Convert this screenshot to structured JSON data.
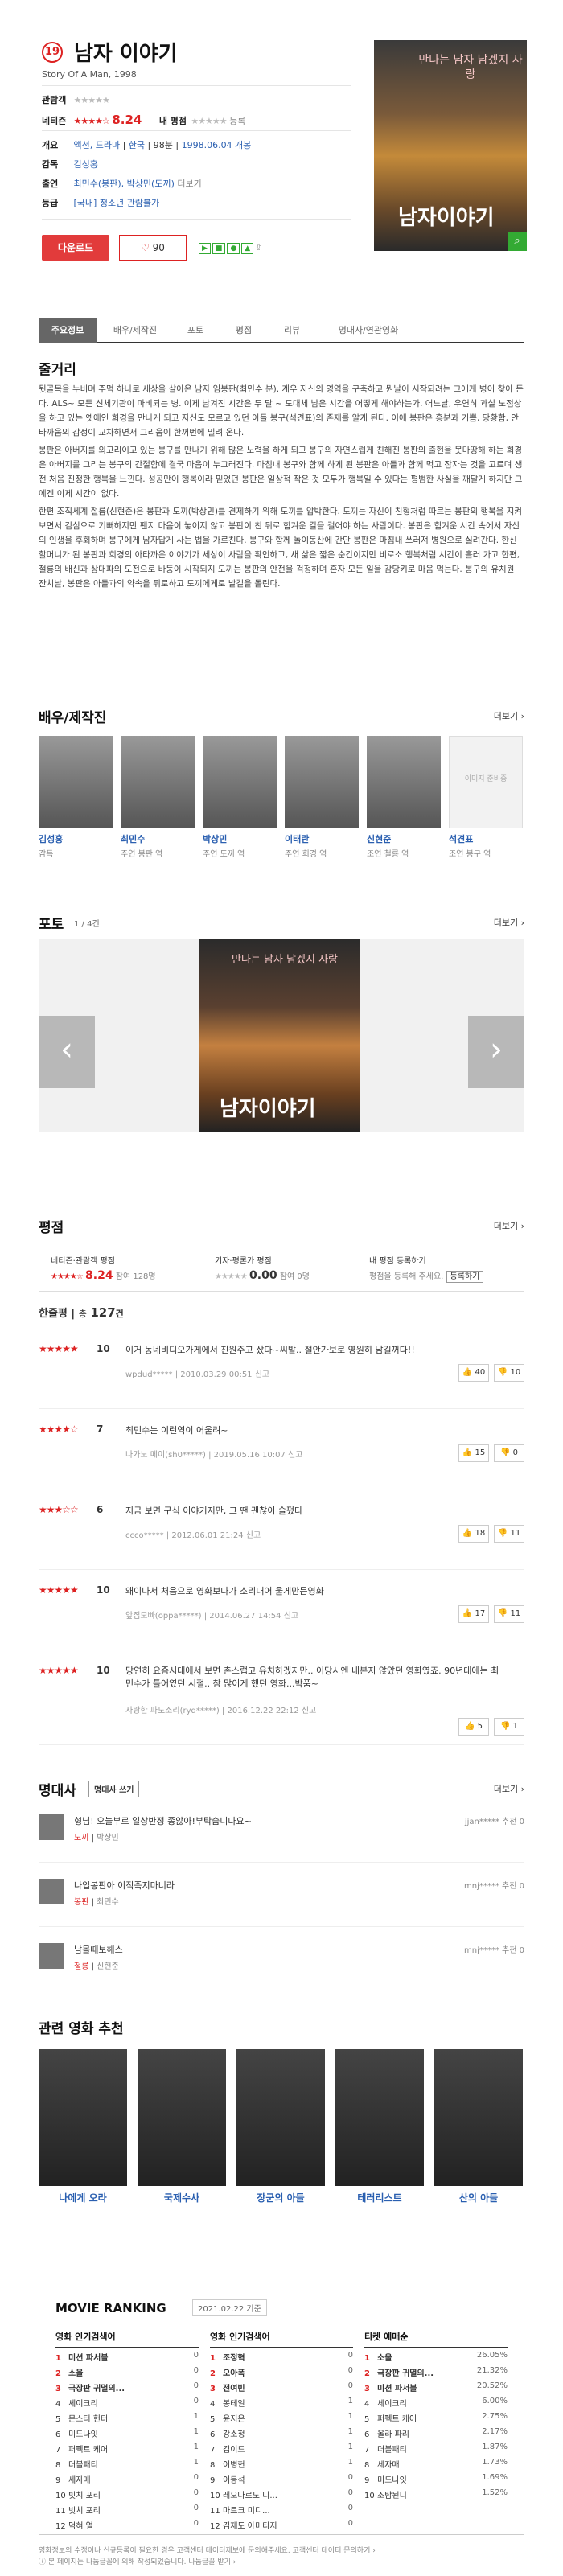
{
  "movie": {
    "rank": "19",
    "title": "남자 이야기",
    "subtitle": "Story Of A Man, 1998",
    "my_rating_label": "관람객",
    "netizen_label": "네티즌",
    "netizen_score": "8.24",
    "my_label": "내 평점",
    "my_link": "등록",
    "genre_label": "개요",
    "genre": "액션, 드라마",
    "country": "한국",
    "runtime": "98분",
    "release": "1998.06.04 개봉",
    "director_label": "감독",
    "director": "김성홍",
    "cast_label": "출연",
    "cast": "최민수(봉판), 박상민(도끼)",
    "cast_more": "더보기",
    "grade_label": "등급",
    "grade": "[국내] 청소년 관람불가",
    "download": "다운로드",
    "likes": "90",
    "poster_title": "남자이야기",
    "poster_sub": "만나는 남자 남겠지 사랑"
  },
  "tabs": [
    "주요정보",
    "배우/제작진",
    "포토",
    "평점",
    "리뷰",
    "명대사/연관영화"
  ],
  "plot": {
    "title": "줄거리",
    "p1": "뒷골목을 누비며 주먹 하나로 세상을 살아온 남자 임봉판(최민수 분). 계우 자신의 영역을 구축하고 뭔날이 시작되려는 그에게 병이 찾아 든다. ALS~ 모든 신체기관이 마비되는 병. 이제 남겨진 시간은 두 달 ~ 도대체 남은 시간을 어떻게 해야하는가. 어느날, 우연히 과실 노점상을 하고 있는 옛애인 희경을 만나게 되고 자신도 모르고 있던 아들 봉구(석견표)의 존재를 알게 된다. 이에 봉판은 흥분과 기쁨, 당황함, 안타까움의 감정이 교차하면서 그리움이 한꺼번에 밀려 온다.",
    "p2": "봉판은 아버지를 외고리이고 있는 봉구를 만나기 위해 많은 노력을 하게 되고 봉구의 자연스럽게 친해진 봉판의 출현을 못마땅해 하는 희경은 아버지를 그리는 봉구의 간절함에 결국 마음이 누그러진다. 마침내 봉구와 함께 하게 된 봉판은 아들과 함께 먹고 잠자는 것을 고르며 생전 처음 진정한 행복을 느낀다. 성공만이 행복이라 믿었던 봉판은 일상적 작은 것 모두가 행복일 수 있다는 평범한 사실을 깨달게 하지만 그에겐 이제 시간이 없다.",
    "p3": "한편 조직세계 절름(신현준)은 봉판과 도끼(박상민)를 견제하기 위해 도끼를 압박한다. 도끼는 자신이 친형처럼 따르는 봉판의 행복을 지켜 보면서 김심으로 기뻐하지만 팬지 마음이 놓이지 않고 봉판이 친 뒤로 힘겨운 길을 걸어야 하는 사람이다. 봉판은 힘겨운 시간 속에서 자신의 인생을 후회하며 봉구에게 남자답게 사는 법을 가르친다. 봉구와 함께 놀이동산에 간단 봉판은 마침내 쓰러져 병원으로 실려간다. 한신할머니가 된 봉판과 희경의 아타까운 이야기가 세상이 사람을 확인하고, 새 삶은 짧은 순간이지만 비로소 행복처럼 시간이 흘러 가고 한편, 철룡의 배신과 상대파의 도전으로 바둥이 시작되지 도끼는 봉판의 안전을 걱정하며 혼자 모든 일을 감당키로 마음 먹는다. 봉구의 유치원 잔치날, 봉판은 아들과의 약속을 뒤로하고 도끼에게로 발길을 돌린다."
  },
  "cast_section": {
    "title": "배우/제작진",
    "more": "더보기",
    "people": [
      {
        "name": "김성홍",
        "role": "감독"
      },
      {
        "name": "최민수",
        "role": "주연 봉판 역"
      },
      {
        "name": "박상민",
        "role": "주연 도끼 역"
      },
      {
        "name": "이태란",
        "role": "주연 희경 역"
      },
      {
        "name": "신현준",
        "role": "조연 철룡 역"
      },
      {
        "name": "석견표",
        "role": "조연 봉구 역"
      }
    ],
    "no_image": "이미지 준비중"
  },
  "photo": {
    "title": "포토",
    "count": "1 / 4건",
    "more": "더보기",
    "poster_title": "남자이야기",
    "poster_sub": "만나는 남자 남겠지 사랑"
  },
  "rating": {
    "title": "평점",
    "more": "더보기",
    "a_label": "네티즌·관람객 평점",
    "a_score": "8.24",
    "a_count": "참여 128명",
    "b_label": "기자·평론가 평점",
    "b_score": "0.00",
    "b_count": "참여 0명",
    "c_label": "내 평점 등록하기",
    "c_desc": "평점을 등록해 주세요.",
    "c_btn": "등록하기",
    "sub": "한줄평",
    "total_label": "총",
    "total": "127",
    "total_unit": "건"
  },
  "comments": [
    {
      "stars": "★★★★★",
      "score": "10",
      "text": "이거 동네비디오가게에서 친원주고 샀다~씨발.. 절안가보로 영원히 남길꺼다!!",
      "meta": "wpdud*****  |  2010.03.29 00:51  신고",
      "like": "40",
      "dislike": "10"
    },
    {
      "stars": "★★★★☆",
      "score": "7",
      "text": "최민수는 이런역이 어울려~",
      "meta": "나가노 메이(sh0*****)  |  2019.05.16 10:07  신고",
      "like": "15",
      "dislike": "0"
    },
    {
      "stars": "★★★☆☆",
      "score": "6",
      "text": "지금 보면 구식 이야기지만, 그 땐 괜찮이 슬펐다",
      "meta": "ccco*****  |  2012.06.01 21:24  신고",
      "like": "18",
      "dislike": "11"
    },
    {
      "stars": "★★★★★",
      "score": "10",
      "text": "왜이나서 처음으로 영화보다가 소리내어 울게만든영화",
      "meta": "앞집모빠(oppa*****)  |  2014.06.27 14:54  신고",
      "like": "17",
      "dislike": "11"
    },
    {
      "stars": "★★★★★",
      "score": "10",
      "text": "당연히 요즘시대에서 보면 촌스럽고 유치하겠지만.. 이당시엔 내본지 않았던 영화였죠. 90년대에는 최민수가 틀어였던 시절.. 참 많이게 했던 영화...박품~",
      "meta": "사랑한 파도소리(ryd*****)  |  2016.12.22 22:12  신고",
      "like": "5",
      "dislike": "1"
    }
  ],
  "quotes": {
    "title": "명대사",
    "btn": "명대사 쓰기",
    "more": "더보기",
    "items": [
      {
        "text": "형님! 오늘부로 일상반정 종않아!부탁습니다요~",
        "role": "도끼",
        "actor": "박상민",
        "user": "jjan*****  추천  0"
      },
      {
        "text": "나입봉판아 이직죽지마너라",
        "role": "봉판",
        "actor": "최민수",
        "user": "mnj*****  추천  0"
      },
      {
        "text": "남몰때보해스",
        "role": "철룡",
        "actor": "신현준",
        "user": "mnj*****  추천  0"
      }
    ]
  },
  "related": {
    "title": "관련 영화 추천",
    "items": [
      {
        "title": "나에게 오라"
      },
      {
        "title": "국제수사"
      },
      {
        "title": "장군의 아들"
      },
      {
        "title": "테러리스트"
      },
      {
        "title": "산의 아들"
      }
    ]
  },
  "ranking": {
    "title": "MOVIE RANKING",
    "date": "2021.02.22 기준",
    "col1": {
      "title": "영화 인기검색어",
      "items": [
        [
          "1",
          "미션 파서블",
          "0"
        ],
        [
          "2",
          "소울",
          "0"
        ],
        [
          "3",
          "극장판 귀멸의...",
          "0"
        ],
        [
          "4",
          "세이크리",
          "0"
        ],
        [
          "5",
          "몬스터 헌터",
          "1"
        ],
        [
          "6",
          "미드나잇",
          "1"
        ],
        [
          "7",
          "퍼펙트 케어",
          "1"
        ],
        [
          "8",
          "더블패티",
          "1"
        ],
        [
          "9",
          "세자매",
          "0"
        ],
        [
          "10",
          "빗치 포리",
          "0"
        ],
        [
          "11",
          "빗치 포리",
          "0"
        ],
        [
          "12",
          "덕혀 얼",
          "0"
        ]
      ]
    },
    "col2": {
      "title": "영화 인기검색어",
      "items": [
        [
          "1",
          "조정혁",
          "0"
        ],
        [
          "2",
          "오아폭",
          "0"
        ],
        [
          "3",
          "전여빈",
          "0"
        ],
        [
          "4",
          "봉테일",
          "1"
        ],
        [
          "5",
          "윤지온",
          "1"
        ],
        [
          "6",
          "강소정",
          "1"
        ],
        [
          "7",
          "김이드",
          "1"
        ],
        [
          "8",
          "이병헌",
          "1"
        ],
        [
          "9",
          "이동석",
          "0"
        ],
        [
          "10",
          "레오나르도 디...",
          "0"
        ],
        [
          "11",
          "마르크 미디...",
          "0"
        ],
        [
          "12",
          "김재도 아미티지",
          "0"
        ]
      ]
    },
    "col3": {
      "title": "티켓 예매순",
      "items": [
        [
          "1",
          "소울",
          "26.05%"
        ],
        [
          "2",
          "극장판 귀멸의...",
          "21.32%"
        ],
        [
          "3",
          "미션 파서블",
          "20.52%"
        ],
        [
          "4",
          "세이크리",
          "6.00%"
        ],
        [
          "5",
          "퍼펙트 케어",
          "2.75%"
        ],
        [
          "6",
          "올라 파리",
          "2.17%"
        ],
        [
          "7",
          "더블패티",
          "1.87%"
        ],
        [
          "8",
          "세자매",
          "1.73%"
        ],
        [
          "9",
          "미드나잇",
          "1.69%"
        ],
        [
          "10",
          "조탐된디",
          "1.52%"
        ]
      ]
    }
  },
  "footer": {
    "line1": "영화정보의 수정이나 신규등록이 필요한 경우 고객센터 데이터제보에 문의해주세요. 고객센터 데이터 문의하기 ›",
    "line2": "ⓘ 본 페이지는 나눔글꼴에 의해 작성되었습니다. 나눔글꼴 받기 ›"
  },
  "colors": {
    "accent": "#e23b3b",
    "link": "#2a5fb0"
  }
}
